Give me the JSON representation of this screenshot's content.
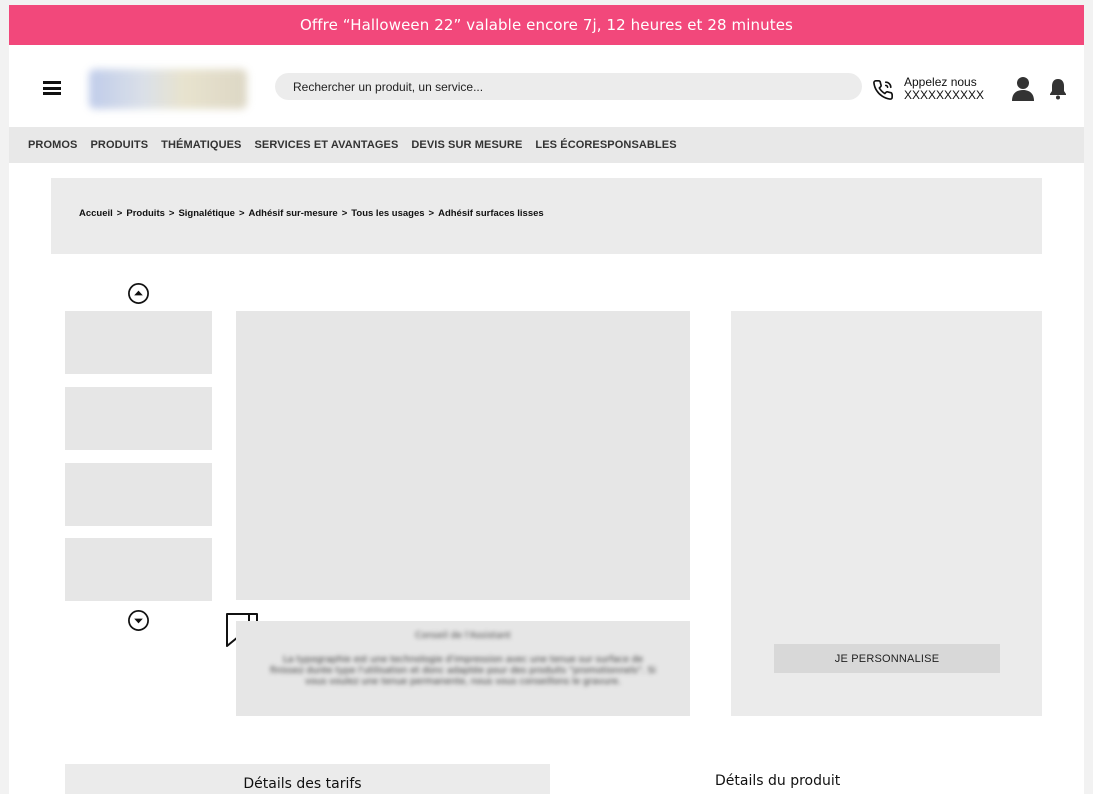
{
  "promo": {
    "text": "Offre “Halloween 22” valable encore 7j, 12 heures et 28 minutes",
    "color": "#f2487b"
  },
  "header": {
    "search_placeholder": "Rechercher un produit, un service...",
    "call_label": "Appelez nous",
    "call_number": "XXXXXXXXXX"
  },
  "nav": {
    "items": [
      {
        "label": "PROMOS"
      },
      {
        "label": "PRODUITS"
      },
      {
        "label": "THÉMATIQUES"
      },
      {
        "label": "SERVICES ET AVANTAGES"
      },
      {
        "label": "DEVIS SUR MESURE"
      },
      {
        "label": "LES ÉCORESPONSABLES"
      }
    ]
  },
  "breadcrumb": {
    "items": [
      {
        "label": "Accueil"
      },
      {
        "label": "Produits"
      },
      {
        "label": "Signalétique"
      },
      {
        "label": "Adhésif sur-mesure"
      },
      {
        "label": "Tous les usages"
      },
      {
        "label": "Adhésif surfaces lisses"
      }
    ],
    "separator": ">"
  },
  "advice": {
    "title": "Conseil de l'Assistant",
    "text": "La typographie est une technologie d'impression avec une tenue sur surface de finissez durée type l'utilisation et donc adaptée pour des produits \"promotionnels\". Si vous voulez une tenue permanente, nous vous conseillons le gravure."
  },
  "config": {
    "customize_label": "JE PERSONNALISE"
  },
  "tabs": {
    "pricing": "Détails des tarifs",
    "product": "Détails du produit"
  },
  "colors": {
    "accent": "#f2487b",
    "placeholder_gray": "#e6e6e6"
  }
}
